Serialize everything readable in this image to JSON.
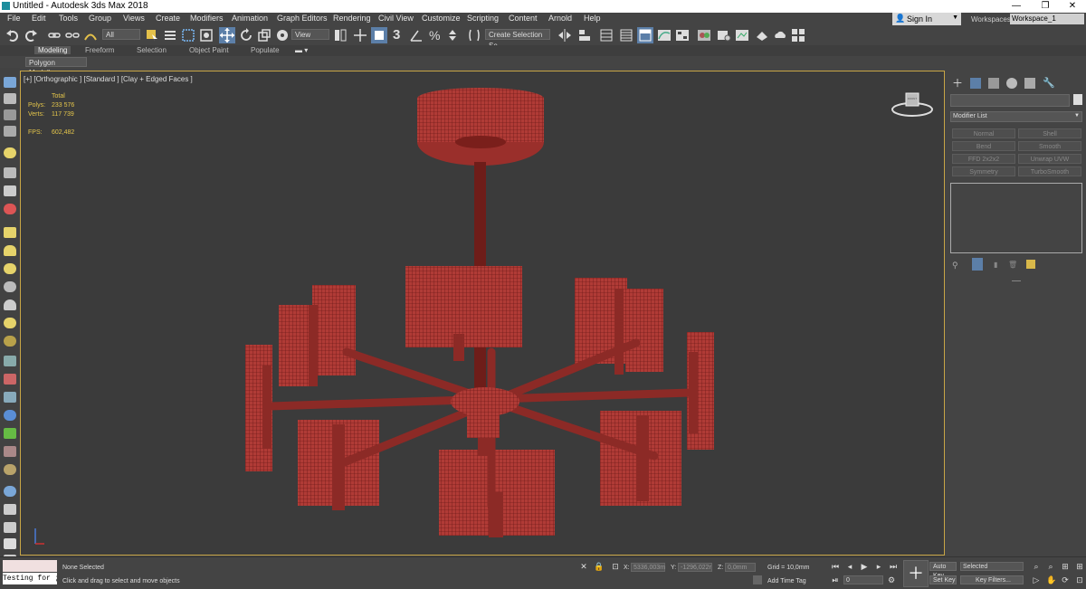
{
  "window": {
    "title": "Untitled - Autodesk 3ds Max 2018",
    "minimize": "—",
    "maximize": "❐",
    "close": "✕"
  },
  "menu": [
    "File",
    "Edit",
    "Tools",
    "Group",
    "Views",
    "Create",
    "Modifiers",
    "Animation",
    "Graph Editors",
    "Rendering",
    "Civil View",
    "Customize",
    "Scripting",
    "Content",
    "Arnold",
    "Help"
  ],
  "account": {
    "sign_in": "Sign In",
    "workspaces_label": "Workspaces:",
    "workspace": "Workspace_1"
  },
  "toolbar": {
    "filter": "All",
    "ref_coord": "View",
    "selection_set": "Create Selection Se"
  },
  "ribbon": {
    "tabs": [
      "Modeling",
      "Freeform",
      "Selection",
      "Object Paint",
      "Populate"
    ],
    "active_tab": "Modeling",
    "panel": "Polygon Modeling"
  },
  "viewport": {
    "label": "[+] [Orthographic ] [Standard ] [Clay + Edged Faces ]",
    "stats": {
      "total_label": "Total",
      "polys_label": "Polys:",
      "polys": "233 576",
      "verts_label": "Verts:",
      "verts": "117 739",
      "fps_label": "FPS:",
      "fps": "602,482"
    },
    "viewcube_label": "FRONT",
    "gizmo_axes": "Z X Y"
  },
  "command_panel": {
    "modifier_list": "Modifier List",
    "modifiers": [
      "Normal",
      "Shell",
      "Bend",
      "Smooth",
      "FFD 2x2x2",
      "Unwrap UVW",
      "Symmetry",
      "TurboSmooth"
    ]
  },
  "status": {
    "script_listener": "Testing for ;",
    "selection": "None Selected",
    "prompt": "Click and drag to select and move objects",
    "x_label": "X:",
    "x": "5336,003m",
    "y_label": "Y:",
    "y": "-1296,022r",
    "z_label": "Z:",
    "z": "0,0mm",
    "grid": "Grid = 10,0mm",
    "add_time_tag": "Add Time Tag",
    "auto_key": "Auto Key",
    "set_key": "Set Key",
    "selected": "Selected",
    "key_filters": "Key Filters...",
    "frame": "0"
  },
  "colors": {
    "model": "#b03b36",
    "wire": "#5a1010",
    "viewport_border": "#c8a646",
    "stats": "#e5c64b"
  }
}
